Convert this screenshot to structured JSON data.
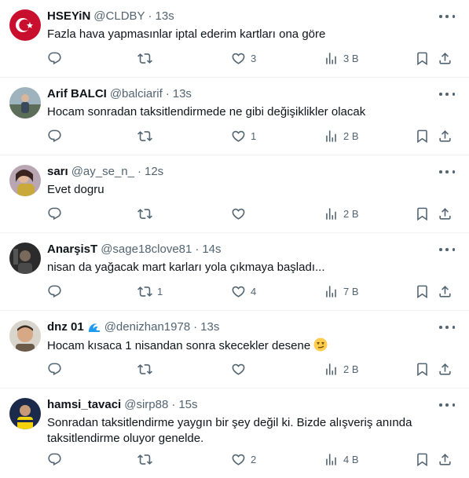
{
  "tweets": [
    {
      "name": "HSEYiN",
      "handle": "@CLDBY",
      "time": "13s",
      "text": "Fazla hava yapmasınlar iptal ederim kartları ona göre",
      "replies": "",
      "retweets": "",
      "likes": "3",
      "views": "3 B"
    },
    {
      "name": "Arif BALCI",
      "handle": "@balciarif",
      "time": "13s",
      "text": "Hocam sonradan taksitlendirmede ne gibi değişiklikler olacak",
      "replies": "",
      "retweets": "",
      "likes": "1",
      "views": "2 B"
    },
    {
      "name": "sarı",
      "handle": "@ay_se_n_",
      "time": "12s",
      "text": "Evet dogru",
      "replies": "",
      "retweets": "",
      "likes": "",
      "views": "2 B"
    },
    {
      "name": "AnarşisT",
      "handle": "@sage18clove81",
      "time": "14s",
      "text": "nisan da yağacak mart karları yola çıkmaya başladı...",
      "replies": "",
      "retweets": "1",
      "likes": "4",
      "views": "7 B"
    },
    {
      "name": "dnz 01",
      "handle": "@denizhan1978",
      "time": "13s",
      "text": "Hocam kısaca 1 nisandan sonra skecekler desene",
      "replies": "",
      "retweets": "",
      "likes": "",
      "views": "2 B"
    },
    {
      "name": "hamsi_tavaci",
      "handle": "@sirp88",
      "time": "15s",
      "text": "Sonradan taksitlendirme yaygın bir şey değil ki. Bizde alışveriş anında taksitlendirme oluyor genelde.",
      "replies": "",
      "retweets": "",
      "likes": "2",
      "views": "4 B"
    }
  ],
  "dot": "·",
  "colors": {
    "text": "#0f1419",
    "secondary": "#536471",
    "divider": "#eff3f4"
  },
  "icons": [
    "reply-icon",
    "retweet-icon",
    "like-icon",
    "views-icon",
    "bookmark-icon",
    "share-icon",
    "more-icon",
    "wave-badge-icon",
    "smirk-emoji-icon"
  ]
}
